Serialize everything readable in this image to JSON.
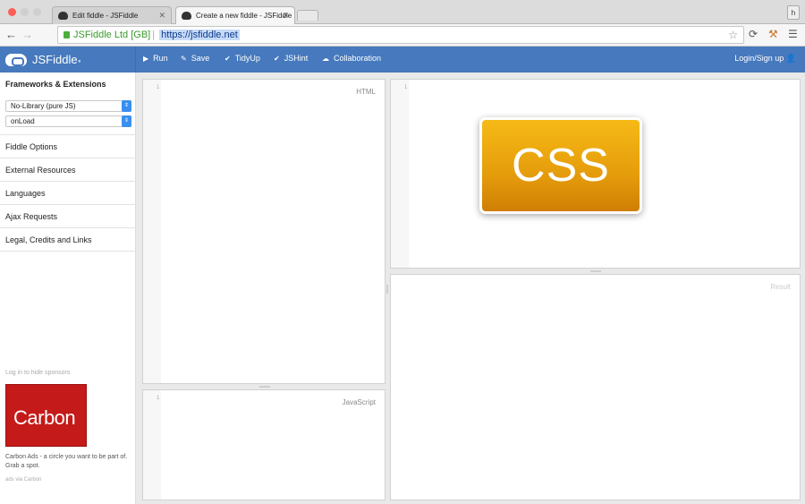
{
  "browser": {
    "tabs": [
      {
        "label": "Edit fiddle - JSFiddle"
      },
      {
        "label": "Create a new fiddle - JSFiddle"
      }
    ],
    "profile_initial": "h",
    "ev_name": "JSFiddle Ltd [GB]",
    "url": "https://jsfiddle.net"
  },
  "header": {
    "logo": "JSFiddle",
    "buttons": [
      {
        "label": "Run"
      },
      {
        "label": "Save"
      },
      {
        "label": "TidyUp"
      },
      {
        "label": "JSHint"
      },
      {
        "label": "Collaboration"
      }
    ],
    "login": "Login/Sign up"
  },
  "sidebar": {
    "title": "Frameworks & Extensions",
    "library_select": "No-Library (pure JS)",
    "load_select": "onLoad",
    "sections": [
      {
        "label": "Fiddle Options"
      },
      {
        "label": "External Resources"
      },
      {
        "label": "Languages"
      },
      {
        "label": "Ajax Requests"
      },
      {
        "label": "Legal, Credits and Links"
      }
    ],
    "sponsor_note": "Log in to hide sponsors",
    "carbon_logo": "Carbon",
    "carbon_desc": "Carbon Ads - a circle you want to be part of. Grab a spot.",
    "ads_via": "ads via Carbon"
  },
  "panels": {
    "html_label": "HTML",
    "css_badge": "CSS",
    "js_label": "JavaScript",
    "result_label": "Result",
    "line_number": "1"
  },
  "colors": {
    "header_bg": "#4679bd",
    "carbon_red": "#c41a1a",
    "css_badge": "#f0a810"
  }
}
